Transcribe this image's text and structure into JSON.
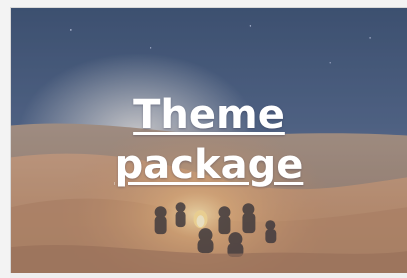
{
  "card": {
    "title_line_1": "Theme",
    "title_line_2": "package",
    "image_icon": "desert-campfire-night-photo",
    "overlay_color": "#8a92b6"
  }
}
